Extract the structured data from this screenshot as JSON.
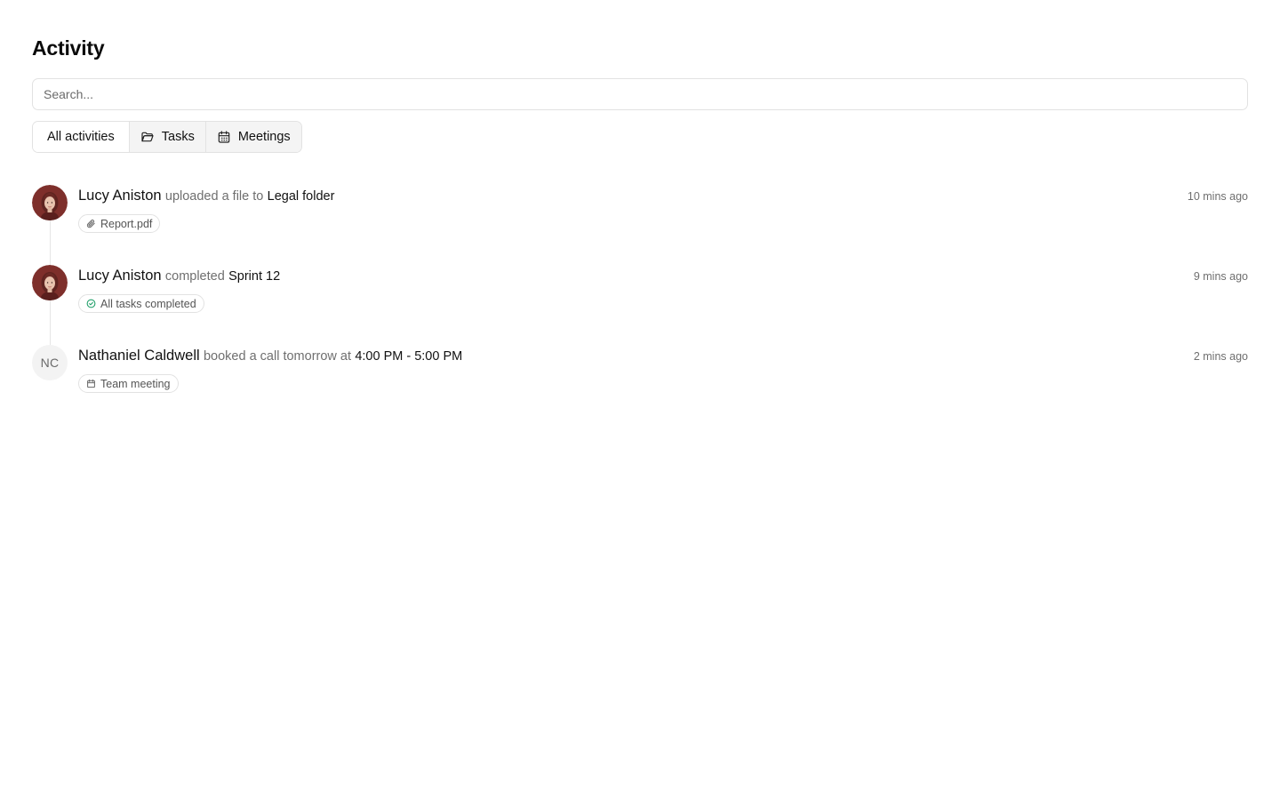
{
  "page": {
    "title": "Activity"
  },
  "search": {
    "placeholder": "Search...",
    "value": ""
  },
  "filters": [
    {
      "label": "All activities",
      "icon": ""
    },
    {
      "label": "Tasks",
      "icon": "folder-icon"
    },
    {
      "label": "Meetings",
      "icon": "calendar-icon"
    }
  ],
  "activities": [
    {
      "actor": "Lucy Aniston",
      "verb": "uploaded a file to",
      "target": "Legal folder",
      "time": "10 mins ago",
      "tag": "Report.pdf",
      "tag_icon": "paperclip-icon",
      "avatar": "photo"
    },
    {
      "actor": "Lucy Aniston",
      "verb": "completed",
      "target": "Sprint 12",
      "time": "9 mins ago",
      "tag": "All tasks completed",
      "tag_icon": "check-circle-icon",
      "avatar": "photo"
    },
    {
      "actor": "Nathaniel Caldwell",
      "verb": "booked a call tomorrow at",
      "target": "4:00 PM - 5:00 PM",
      "time": "2 mins ago",
      "tag": "Team meeting",
      "tag_icon": "calendar-icon",
      "avatar_initials": "NC"
    }
  ],
  "colors": {
    "success": "#22a06b",
    "muted": "#6f6f6f",
    "border": "#e2e2e2"
  }
}
